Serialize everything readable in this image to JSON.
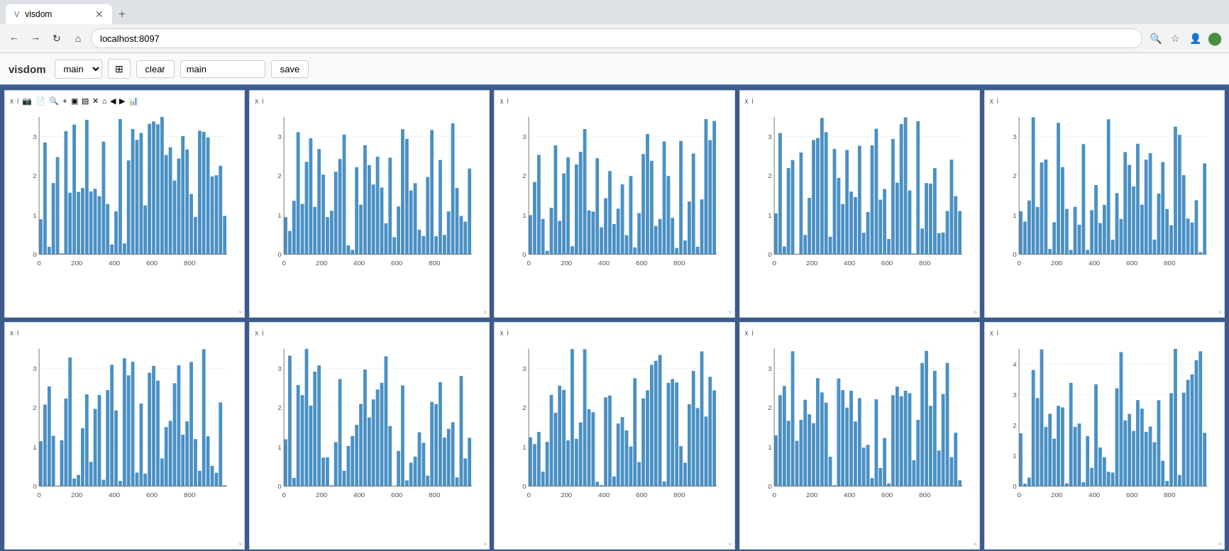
{
  "browser": {
    "tab_title": "visdom",
    "tab_favicon": "V",
    "address": "localhost:8097",
    "new_tab_label": "+"
  },
  "toolbar": {
    "logo": "visdom",
    "env_value": "main",
    "env_options": [
      "main"
    ],
    "grid_icon": "⊞",
    "clear_label": "clear",
    "env_input_value": "main",
    "save_label": "save"
  },
  "charts": {
    "count": 10,
    "rows": 2,
    "cols": 5,
    "y_labels": [
      "0",
      "1",
      "2",
      "3"
    ],
    "x_labels": [
      "0",
      "200",
      "400",
      "600",
      "800"
    ],
    "panels": [
      {
        "id": 1,
        "max_y": 3.5,
        "has_toolbar": true
      },
      {
        "id": 2,
        "max_y": 3.5,
        "has_toolbar": false
      },
      {
        "id": 3,
        "max_y": 3.5,
        "has_toolbar": false
      },
      {
        "id": 4,
        "max_y": 3.5,
        "has_toolbar": false
      },
      {
        "id": 5,
        "max_y": 3.5,
        "has_toolbar": false
      },
      {
        "id": 6,
        "max_y": 3.5,
        "has_toolbar": false
      },
      {
        "id": 7,
        "max_y": 3.5,
        "has_toolbar": false
      },
      {
        "id": 8,
        "max_y": 3.5,
        "has_toolbar": false
      },
      {
        "id": 9,
        "max_y": 3.5,
        "has_toolbar": false
      },
      {
        "id": 10,
        "max_y": 4.5,
        "has_toolbar": false
      }
    ]
  },
  "panel_icons": {
    "close": "x",
    "info": "i",
    "camera": "📷",
    "download": "⬇",
    "zoom_in": "🔍",
    "plus": "+",
    "square1": "▣",
    "square2": "▤",
    "lasso": "⊗",
    "home": "⌂",
    "left_bars": "◀",
    "right_bars": "▶",
    "chart": "📊",
    "resize": "»"
  },
  "colors": {
    "background": "#3d5a8a",
    "panel_bg": "#ffffff",
    "bar_color": "#4a90c4",
    "toolbar_bg": "#f8f9fa",
    "border": "#d0d8e8"
  }
}
